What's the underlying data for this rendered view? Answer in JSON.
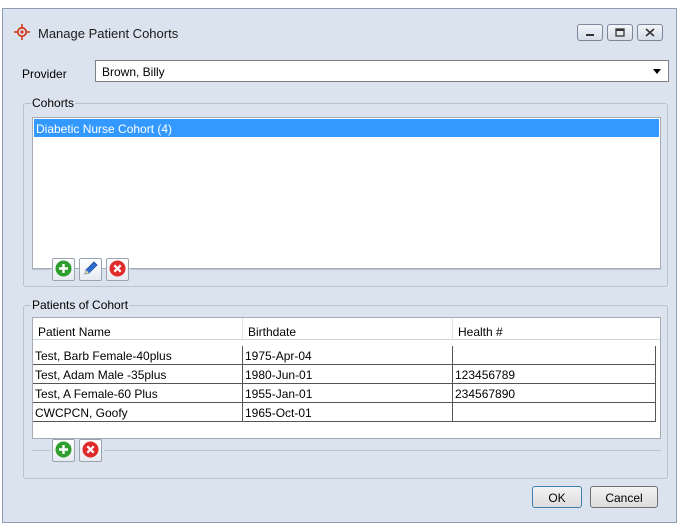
{
  "window": {
    "title": "Manage Patient Cohorts",
    "controls": [
      "minimize-icon",
      "maximize-icon",
      "close-icon"
    ]
  },
  "provider": {
    "label": "Provider",
    "selected": "Brown, Billy"
  },
  "cohorts": {
    "group_title": "Cohorts",
    "items": [
      "Diabetic Nurse Cohort (4)"
    ],
    "selected_index": 0,
    "buttons": [
      "add-icon",
      "edit-icon",
      "delete-icon"
    ]
  },
  "patients": {
    "group_title": "Patients of Cohort",
    "columns": [
      "Patient Name",
      "Birthdate",
      "Health #"
    ],
    "rows": [
      [
        "Test, Barb Female-40plus",
        "1975-Apr-04",
        ""
      ],
      [
        "Test, Adam Male -35plus",
        "1980-Jun-01",
        "123456789"
      ],
      [
        "Test, A Female-60 Plus",
        "1955-Jan-01",
        "234567890"
      ],
      [
        "CWCPCN, Goofy",
        "1965-Oct-01",
        ""
      ]
    ],
    "buttons": [
      "add-icon",
      "delete-icon"
    ]
  },
  "actions": {
    "ok": "OK",
    "cancel": "Cancel"
  },
  "colors": {
    "selection": "#3399ff",
    "add": "#2e9e2e",
    "delete": "#e02b2b",
    "edit": "#2f6fd0",
    "window_bg": "#dbe3ef"
  }
}
